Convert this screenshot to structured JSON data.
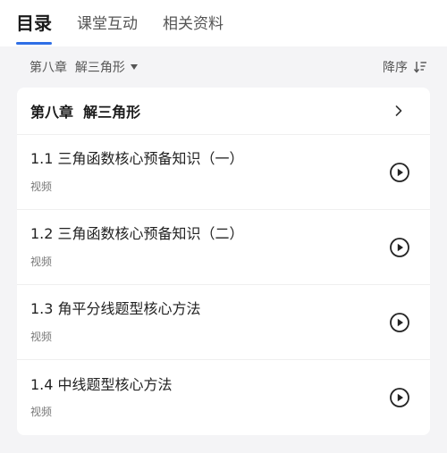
{
  "tabs": [
    {
      "label": "目录",
      "active": true
    },
    {
      "label": "课堂互动",
      "active": false
    },
    {
      "label": "相关资料",
      "active": false
    }
  ],
  "filter": {
    "chapter_label": "第八章  解三角形",
    "sort_label": "降序"
  },
  "chapter": {
    "title": "第八章  解三角形"
  },
  "lessons": [
    {
      "title": "1.1 三角函数核心预备知识（一）",
      "type": "视频"
    },
    {
      "title": "1.2 三角函数核心预备知识（二）",
      "type": "视频"
    },
    {
      "title": "1.3 角平分线题型核心方法",
      "type": "视频"
    },
    {
      "title": "1.4 中线题型核心方法",
      "type": "视频"
    }
  ],
  "colors": {
    "accent": "#2f6fe6",
    "background": "#f4f4f6"
  },
  "icons": {
    "dropdown": "caret-down-icon",
    "sort": "sort-descending-icon",
    "chapter_arrow": "chevron-right-icon",
    "lesson_action": "play-circle-icon"
  }
}
